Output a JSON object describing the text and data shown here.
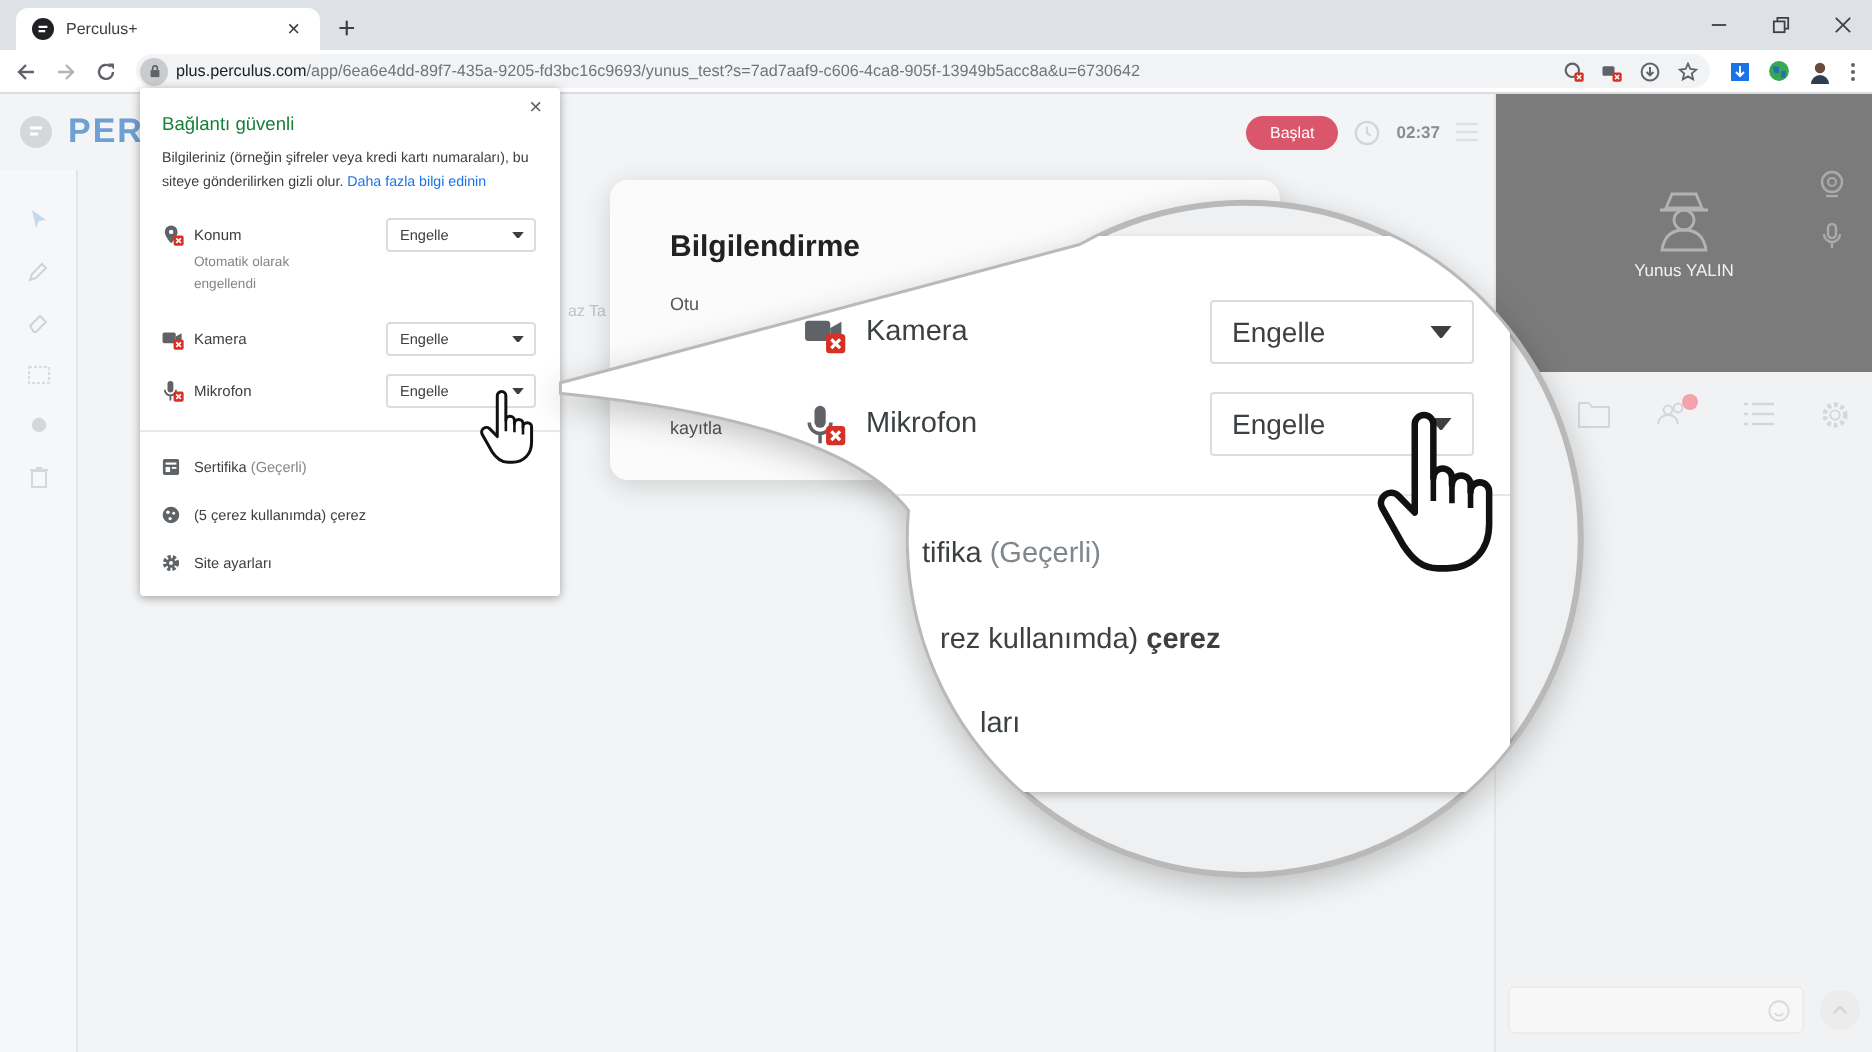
{
  "browser": {
    "tab": {
      "title": "Perculus+",
      "close": "×"
    },
    "new_tab": "+",
    "address": {
      "host": "plus.perculus.com",
      "path": "/app/6ea6e4dd-89f7-435a-9205-fd3bc16c9693/yunus_test?s=7ad7aaf9-c606-4ca8-905f-13949b5acc8a&u=6730642"
    }
  },
  "app": {
    "logo": "PER",
    "start_button": "Başlat",
    "timer": "02:37",
    "behind_text": "az Ta",
    "participant": {
      "name": "Yunus YALIN"
    },
    "dialog": {
      "title": "Bilgilendirme",
      "line_1": "Otu",
      "line_2": "kayıtla"
    }
  },
  "site_info": {
    "title": "Bağlantı güvenli",
    "close": "×",
    "description": "Bilgileriniz (örneğin şifreler veya kredi kartı numaraları), bu siteye gönderilirken gizli olur.",
    "link": "Daha fazla bilgi edinin",
    "permissions": [
      {
        "kind": "location",
        "label": "Konum",
        "note": "Otomatik olarak engellendi",
        "value": "Engelle"
      },
      {
        "kind": "camera",
        "label": "Kamera",
        "value": "Engelle"
      },
      {
        "kind": "mic",
        "label": "Mikrofon",
        "value": "Engelle"
      }
    ],
    "items": [
      {
        "kind": "certificate",
        "label": "Sertifika",
        "detail": "(Geçerli)"
      },
      {
        "kind": "cookie",
        "label": "(5 çerez kullanımda) çerez"
      },
      {
        "kind": "settings",
        "label": "Site ayarları"
      }
    ]
  },
  "magnifier": {
    "permissions": [
      {
        "kind": "camera",
        "label": "Kamera",
        "value": "Engelle"
      },
      {
        "kind": "mic",
        "label": "Mikrofon",
        "value": "Engelle"
      }
    ],
    "items": [
      {
        "label": "tifika",
        "detail": "(Geçerli)"
      },
      {
        "label": "rez kullanımda) **çerez**"
      },
      {
        "label": "ları"
      }
    ]
  }
}
